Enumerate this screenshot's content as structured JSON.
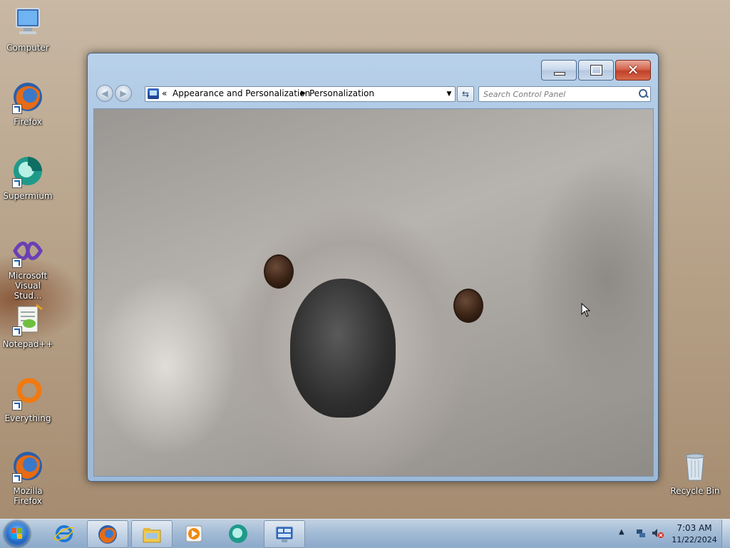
{
  "desktop": {
    "icons": [
      {
        "label": "Computer",
        "icon": "computer-icon"
      },
      {
        "label": "Firefox",
        "icon": "firefox-icon"
      },
      {
        "label": "Supermium",
        "icon": "supermium-icon"
      },
      {
        "label": "Microsoft Visual Stud...",
        "icon": "visual-studio-icon"
      },
      {
        "label": "Notepad++",
        "icon": "notepad-plus-plus-icon"
      },
      {
        "label": "Everything",
        "icon": "everything-icon"
      },
      {
        "label": "Mozilla Firefox",
        "icon": "firefox-icon"
      },
      {
        "label": "Recycle Bin",
        "icon": "recycle-bin-icon"
      }
    ]
  },
  "window": {
    "breadcrumb": {
      "overflow": "«",
      "items": [
        "Appearance and Personalization",
        "Personalization"
      ]
    },
    "search": {
      "placeholder": "Search Control Panel"
    },
    "controls": {
      "minimize": "minimize-icon",
      "maximize": "maximize-icon",
      "close": "close-icon"
    }
  },
  "taskbar": {
    "pinned": [
      "internet-explorer-icon",
      "firefox-icon",
      "windows-explorer-icon",
      "media-player-icon",
      "supermium-icon",
      "control-panel-icon"
    ],
    "clock": {
      "time": "7:03 AM",
      "date": "11/22/2024"
    },
    "tray": [
      "show-hidden-icons-arrow",
      "network-icon",
      "volume-muted-icon"
    ]
  },
  "colors": {
    "window_frame": "#a7c2df",
    "close_button": "#c0412a",
    "taskbar": "#a0bcda"
  }
}
